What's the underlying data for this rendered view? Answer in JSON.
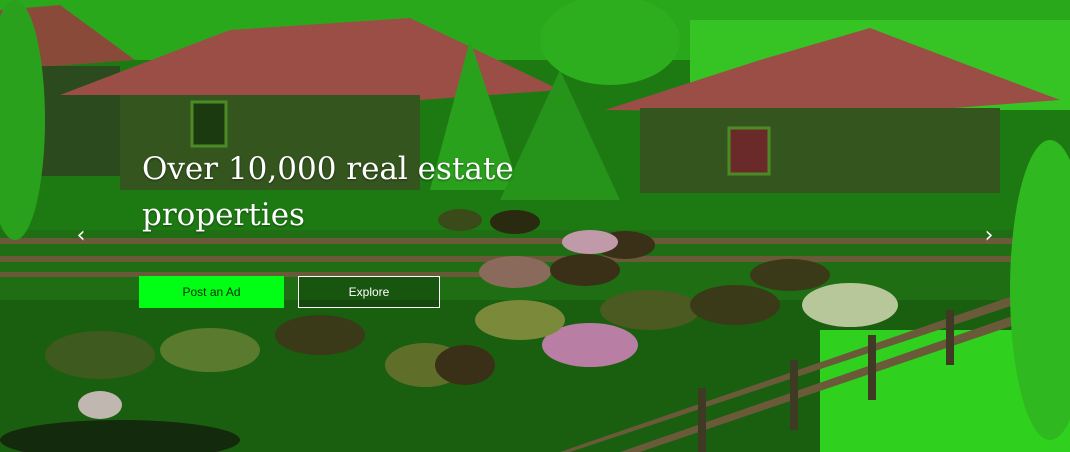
{
  "hero": {
    "headline": "Over 10,000  real estate\nproperties",
    "primary_button": "Post an Ad",
    "secondary_button": "Explore",
    "prev_glyph": "‹",
    "next_glyph": "›"
  },
  "colors": {
    "accent": "#00ff14",
    "tint": "#1c8a14"
  }
}
